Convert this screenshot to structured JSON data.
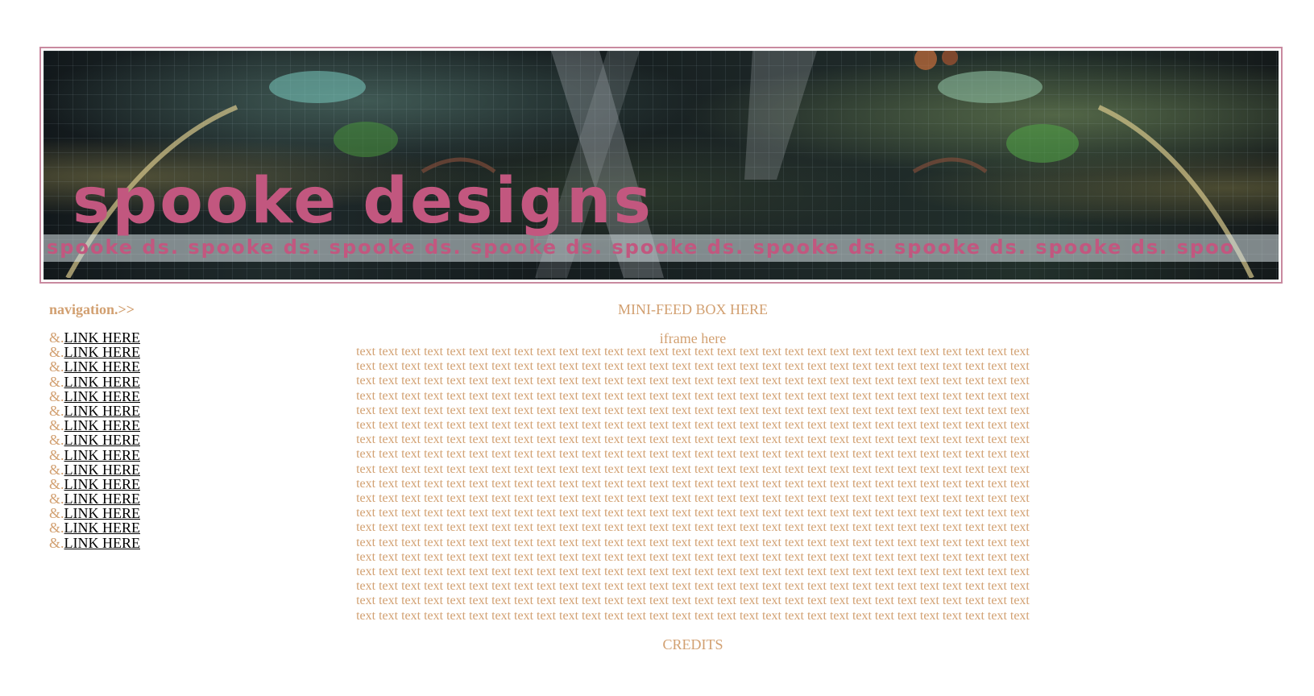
{
  "banner": {
    "title": "spooke designs",
    "stripe_text": "spooke ds. spooke ds. spooke ds. spooke ds. spooke ds. spooke ds. spooke ds. spooke ds. spoo"
  },
  "navigation": {
    "heading": "navigation.>>",
    "bullet": "&.",
    "links": [
      "LINK HERE",
      "LINK HERE",
      "LINK HERE",
      "LINK HERE",
      "LINK HERE",
      "LINK HERE",
      "LINK HERE",
      "LINK HERE",
      "LINK HERE",
      "LINK HERE",
      "LINK HERE",
      "LINK HERE",
      "LINK HERE",
      "LINK HERE",
      "LINK HERE"
    ]
  },
  "main": {
    "minifeed_label": "MINI-FEED BOX HERE",
    "iframe_label": "iframe here",
    "text_lines": [
      "text text text text text text text text text text text text text text text text text text text text text text text text text text text text text text",
      "text text text text text text text text text text text text text text text text text text text text text text text text text text text text text text",
      "text text text text text text text text text text text text text text text text text text text text text text text text text text text text text text",
      "text text text text text text text text text text text text text text text text text text text text text text text text text text text text text text",
      "text text text text text text text text text text text text text text text text text text text text text text text text text text text text text text",
      "text text text text text text text text text text text text text text text text text text text text text text text text text text text text text text",
      "text text text text text text text text text text text text text text text text text text text text text text text text text text text text text text",
      "text text text text text text text text text text text text text text text text text text text text text text text text text text text text text text",
      "text text text text text text text text text text text text text text text text text text text text text text text text text text text text text text",
      "text text text text text text text text text text text text text text text text text text text text text text text text text text text text text text",
      "text text text text text text text text text text text text text text text text text text text text text text text text text text text text text text",
      "text text text text text text text text text text text text text text text text text text text text text text text text text text text text text text",
      "text text text text text text text text text text text text text text text text text text text text text text text text text text text text text text",
      "text text text text text text text text text text text text text text text text text text text text text text text text text text text text text text",
      "text text text text text text text text text text text text text text text text text text text text text text text text text text text text text text",
      "text text text text text text text text text text text text text text text text text text text text text text text text text text text text text text",
      "text text text text text text text text text text text text text text text text text text text text text text text text text text text text text text",
      "text text text text text text text text text text text text text text text text text text text text text text text text text text text text text text",
      "text text text text text text text text text text text text text text text text text text text text text text text text text text text text text text"
    ],
    "credits_label": "CREDITS"
  },
  "colors": {
    "accent_text": "#d2a071",
    "banner_title": "#c2577f",
    "banner_border": "#c98aa0",
    "link": "#000000"
  }
}
